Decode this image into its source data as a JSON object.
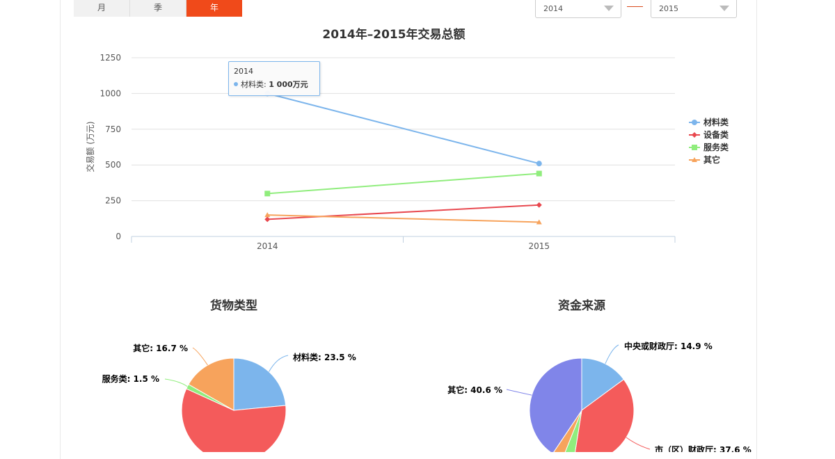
{
  "tabs": [
    {
      "label": "月",
      "active": false
    },
    {
      "label": "季",
      "active": false
    },
    {
      "label": "年",
      "active": true
    }
  ],
  "year_from": "2014",
  "year_to": "2015",
  "tooltip": {
    "title": "2014",
    "series": "材料类",
    "value": "1 000万元",
    "color": "#7cb5ec"
  },
  "chart_data": [
    {
      "type": "line",
      "title": "2014年–2015年交易总额",
      "ylabel": "交易额 (万元)",
      "xlabel": "",
      "categories": [
        "2014",
        "2015"
      ],
      "ylim": [
        0,
        1250
      ],
      "yticks": [
        0,
        250,
        500,
        750,
        1000,
        1250
      ],
      "grid": true,
      "legend": "right",
      "series": [
        {
          "name": "材料类",
          "values": [
            1000,
            510
          ],
          "color": "#7cb5ec",
          "marker": "circle"
        },
        {
          "name": "设备类",
          "values": [
            120,
            220
          ],
          "color": "#e8484f",
          "marker": "diamond"
        },
        {
          "name": "服务类",
          "values": [
            300,
            440
          ],
          "color": "#90ed7d",
          "marker": "square"
        },
        {
          "name": "其它",
          "values": [
            150,
            100
          ],
          "color": "#f7a35c",
          "marker": "triangle"
        }
      ]
    },
    {
      "type": "pie",
      "title": "货物类型",
      "slices": [
        {
          "name": "材料类",
          "value": 23.5,
          "label": "材料类: 23.5 %",
          "color": "#7cb5ec"
        },
        {
          "name": "设备类",
          "value": 58.3,
          "label": "",
          "color": "#f45b5b"
        },
        {
          "name": "服务类",
          "value": 1.5,
          "label": "服务类: 1.5 %",
          "color": "#90ed7d"
        },
        {
          "name": "其它",
          "value": 16.7,
          "label": "其它: 16.7 %",
          "color": "#f7a35c"
        }
      ]
    },
    {
      "type": "pie",
      "title": "资金来源",
      "slices": [
        {
          "name": "中央或财政厅",
          "value": 14.9,
          "label": "中央或财政厅: 14.9 %",
          "color": "#7cb5ec"
        },
        {
          "name": "市（区）财政厅",
          "value": 37.6,
          "label": "市（区）财政厅: 37.6 %",
          "color": "#f45b5b"
        },
        {
          "name": "",
          "value": 3.5,
          "label": "",
          "color": "#90ed7d"
        },
        {
          "name": "",
          "value": 3.4,
          "label": "",
          "color": "#f7a35c"
        },
        {
          "name": "其它",
          "value": 40.6,
          "label": "其它: 40.6 %",
          "color": "#8085e9"
        }
      ]
    }
  ]
}
